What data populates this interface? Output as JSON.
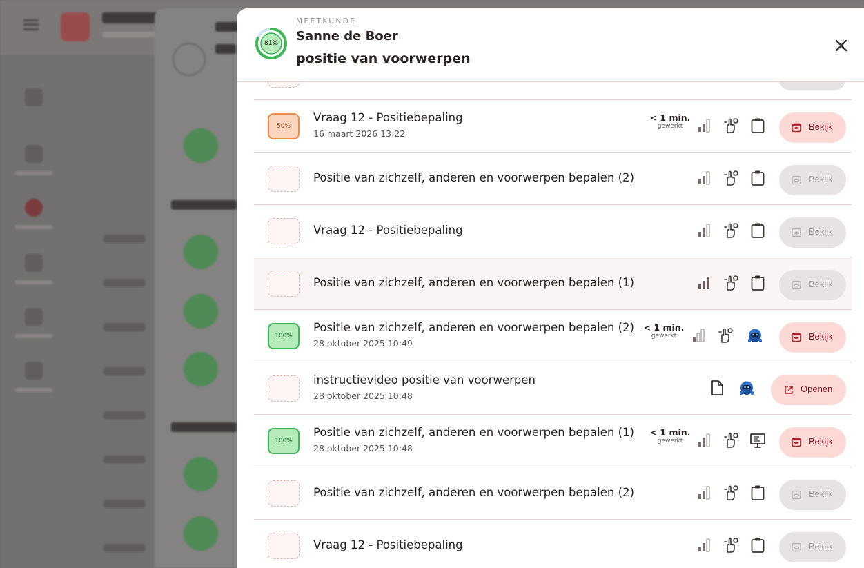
{
  "modal": {
    "subject": "MEETKUNDE",
    "student": "Sanne de Boer",
    "topic": "positie van voorwerpen",
    "progress_label": "81%",
    "progress_value": 0.81
  },
  "colors": {
    "accent": "#fcd9d5",
    "accent_text": "#7b1a22",
    "success": "#3fb657",
    "warning": "#ef8b4c"
  },
  "rows": [
    {
      "badge": "50%",
      "title": "Vraag 12 - Positiebepaling",
      "date": "16 maart 2026 13:22",
      "time": "< 1 min.",
      "time_sub": "gewerkt",
      "button": "Bekijk"
    },
    {
      "badge": "",
      "title": "Positie van zichzelf, anderen en voorwerpen bepalen (2)",
      "button": "Bekijk"
    },
    {
      "badge": "",
      "title": "Vraag 12 - Positiebepaling",
      "button": "Bekijk"
    },
    {
      "badge": "",
      "title": "Positie van zichzelf, anderen en voorwerpen bepalen (1)",
      "button": "Bekijk"
    },
    {
      "badge": "100%",
      "title": "Positie van zichzelf, anderen en voorwerpen bepalen (2)",
      "date": "28 oktober 2025 10:49",
      "time": "< 1 min.",
      "time_sub": "gewerkt",
      "button": "Bekijk"
    },
    {
      "badge": "",
      "title": "instructievideo positie van voorwerpen",
      "date": "28 oktober 2025 10:48",
      "button": "Openen"
    },
    {
      "badge": "100%",
      "title": "Positie van zichzelf, anderen en voorwerpen bepalen (1)",
      "date": "28 oktober 2025 10:48",
      "time": "< 1 min.",
      "time_sub": "gewerkt",
      "button": "Bekijk"
    },
    {
      "badge": "",
      "title": "Positie van zichzelf, anderen en voorwerpen bepalen (2)",
      "button": "Bekijk"
    },
    {
      "badge": "",
      "title": "Vraag 12 - Positiebepaling",
      "button": "Bekijk"
    }
  ],
  "icons": [
    "bar-chart-icon",
    "hand-tap-icon",
    "clipboard-icon",
    "robot-icon",
    "document-icon",
    "presentation-icon",
    "eye-icon",
    "external-link-icon",
    "close-icon"
  ]
}
